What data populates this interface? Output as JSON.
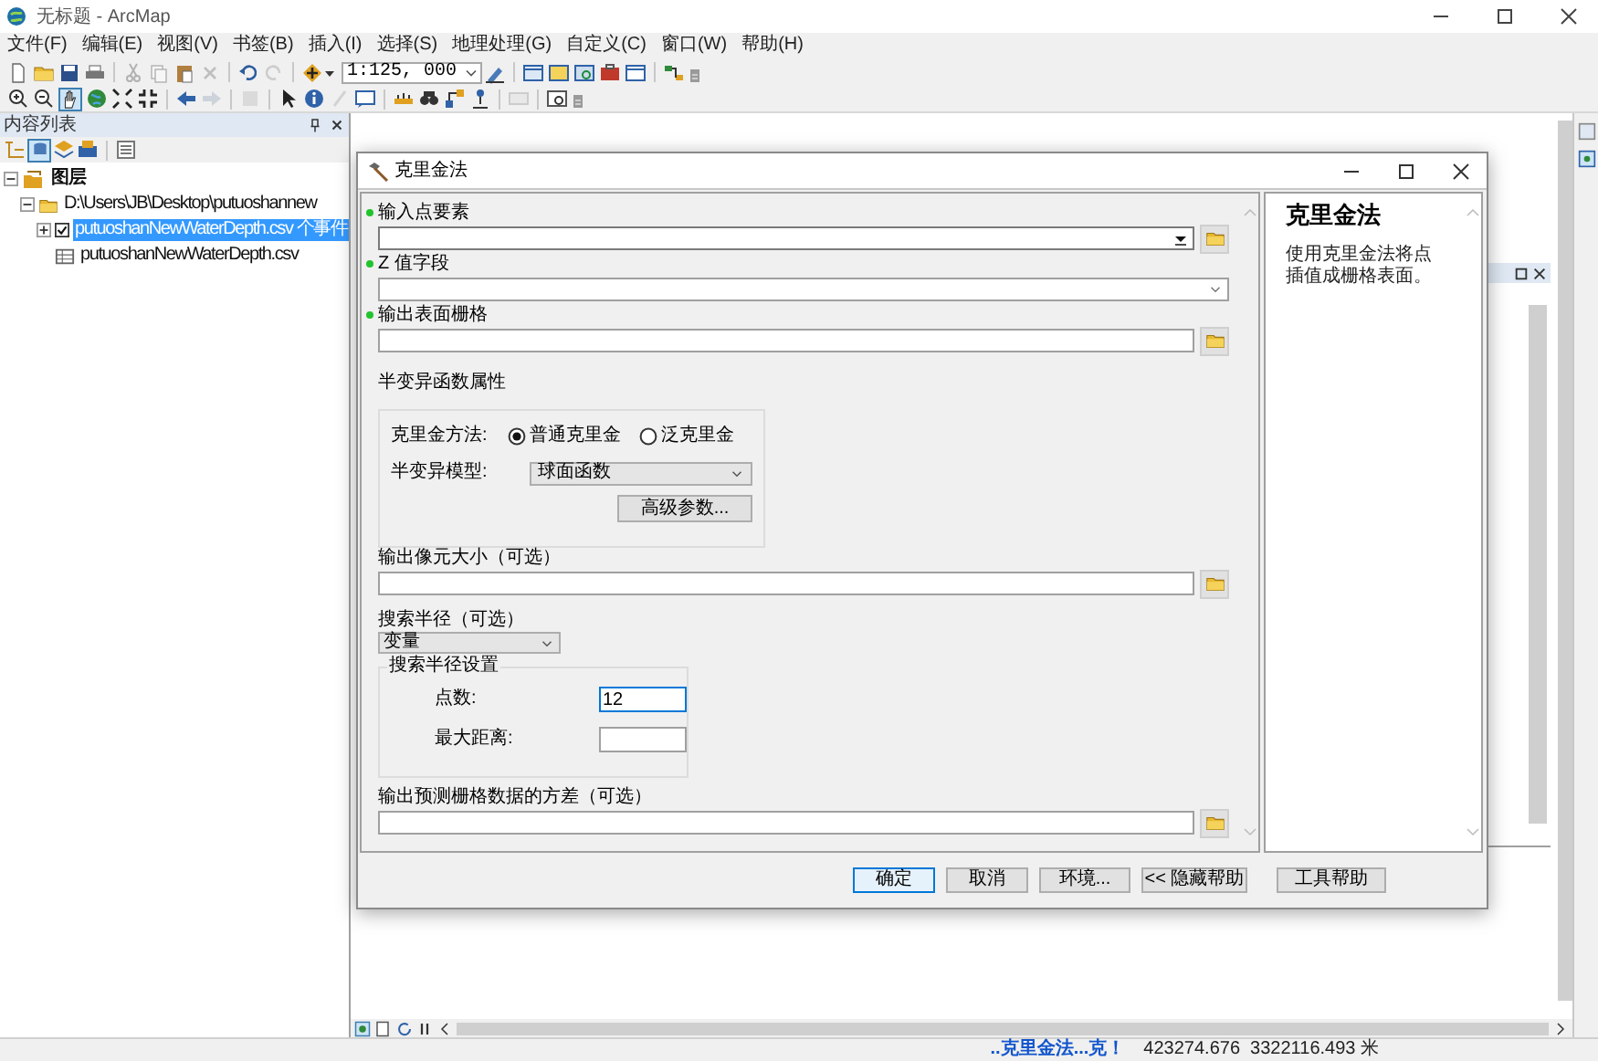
{
  "window": {
    "title": "无标题 - ArcMap"
  },
  "menu": [
    "文件(F)",
    "编辑(E)",
    "视图(V)",
    "书签(B)",
    "插入(I)",
    "选择(S)",
    "地理处理(G)",
    "自定义(C)",
    "窗口(W)",
    "帮助(H)"
  ],
  "toolbar": {
    "scale": "1:125, 000"
  },
  "toc": {
    "title": "内容列表",
    "tree": [
      {
        "label": "图层",
        "kind": "frame",
        "expanded": true,
        "selected": false,
        "children": [
          {
            "label": "D:\\Users\\JB\\Desktop\\putuoshannew",
            "kind": "folder",
            "expanded": true,
            "selected": false,
            "children": [
              {
                "label": "putuoshanNewWaterDepth.csv 个事件",
                "kind": "layer",
                "expanded": false,
                "checked": true,
                "selected": true
              },
              {
                "label": "putuoshanNewWaterDepth.csv",
                "kind": "table",
                "selected": false
              }
            ]
          }
        ]
      }
    ]
  },
  "dialog": {
    "title": "克里金法",
    "params": [
      {
        "kind": "combo",
        "label": "输入点要素",
        "required": true,
        "browse": true
      },
      {
        "kind": "dropdown",
        "label": "Z 值字段",
        "required": true,
        "browse": false
      },
      {
        "kind": "text",
        "label": "输出表面栅格",
        "required": true,
        "browse": true
      },
      {
        "kind": "semivariogram",
        "label": "半变异函数属性",
        "method_label": "克里金方法:",
        "methods": [
          {
            "label": "普通克里金",
            "selected": true
          },
          {
            "label": "泛克里金",
            "selected": false
          }
        ],
        "model_label": "半变异模型:",
        "model": "球面函数",
        "advanced": "高级参数..."
      },
      {
        "kind": "text",
        "label": "输出像元大小（可选）",
        "required": false,
        "browse": true
      },
      {
        "kind": "search_radius",
        "label": "搜索半径（可选）",
        "type": "变量",
        "group_label": "搜索半径设置",
        "rows": [
          {
            "label": "点数:",
            "value": "12",
            "focused": true
          },
          {
            "label": "最大距离:",
            "focused": false
          }
        ]
      },
      {
        "kind": "text",
        "label": "输出预测栅格数据的方差（可选）",
        "required": false,
        "browse": true
      }
    ],
    "help": {
      "title": "克里金法",
      "text": "使用克里金法将点插值成栅格表面。"
    },
    "buttons": [
      {
        "label": "确定",
        "default": true
      },
      {
        "label": "取消",
        "default": false
      },
      {
        "label": "环境...",
        "default": false
      },
      {
        "label": "<< 隐藏帮助",
        "default": false
      },
      {
        "label": "工具帮助",
        "default": false
      }
    ]
  },
  "status_bar": {
    "progress": "..克里金法...克！",
    "coordinates": "423274.676  3322116.493 米"
  }
}
